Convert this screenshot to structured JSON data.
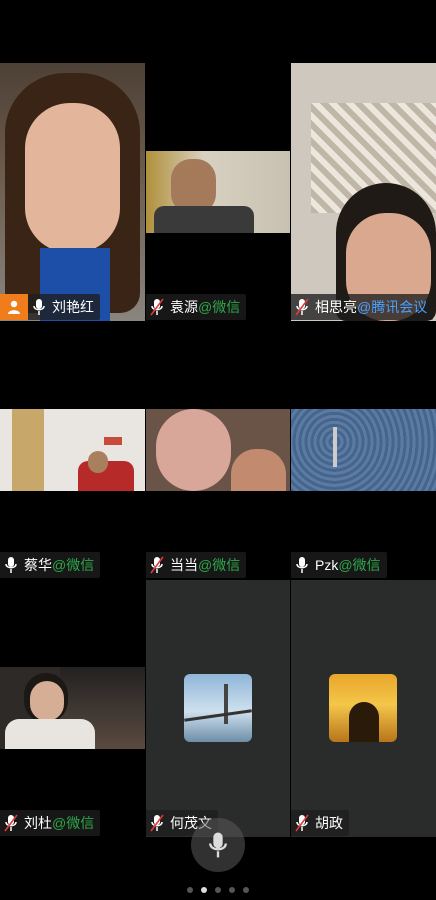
{
  "participants": [
    {
      "name": "刘艳红",
      "suffix": "",
      "host": true
    },
    {
      "name": "袁源",
      "suffix": "@微信"
    },
    {
      "name": "相思亮",
      "suffix": "@腾讯会议"
    },
    {
      "name": "蔡华",
      "suffix": "@微信"
    },
    {
      "name": "当当",
      "suffix": "@微信"
    },
    {
      "name": "Pzk",
      "suffix": "@微信"
    },
    {
      "name": "刘杜",
      "suffix": "@微信"
    },
    {
      "name": "何茂文",
      "suffix": ""
    },
    {
      "name": "胡政",
      "suffix": ""
    }
  ],
  "colors": {
    "background": "#000000",
    "label_bg": "#1e1e1e",
    "wechat_suffix": "#2ea84a",
    "tencent_suffix": "#4aa0ff",
    "host_badge": "#f07d1b",
    "tile_dark": "#2a2c2b"
  },
  "icons": [
    "microphone-muted-icon",
    "host-person-icon",
    "microphone-icon"
  ],
  "pagination": {
    "pages": 5,
    "current": 2
  }
}
